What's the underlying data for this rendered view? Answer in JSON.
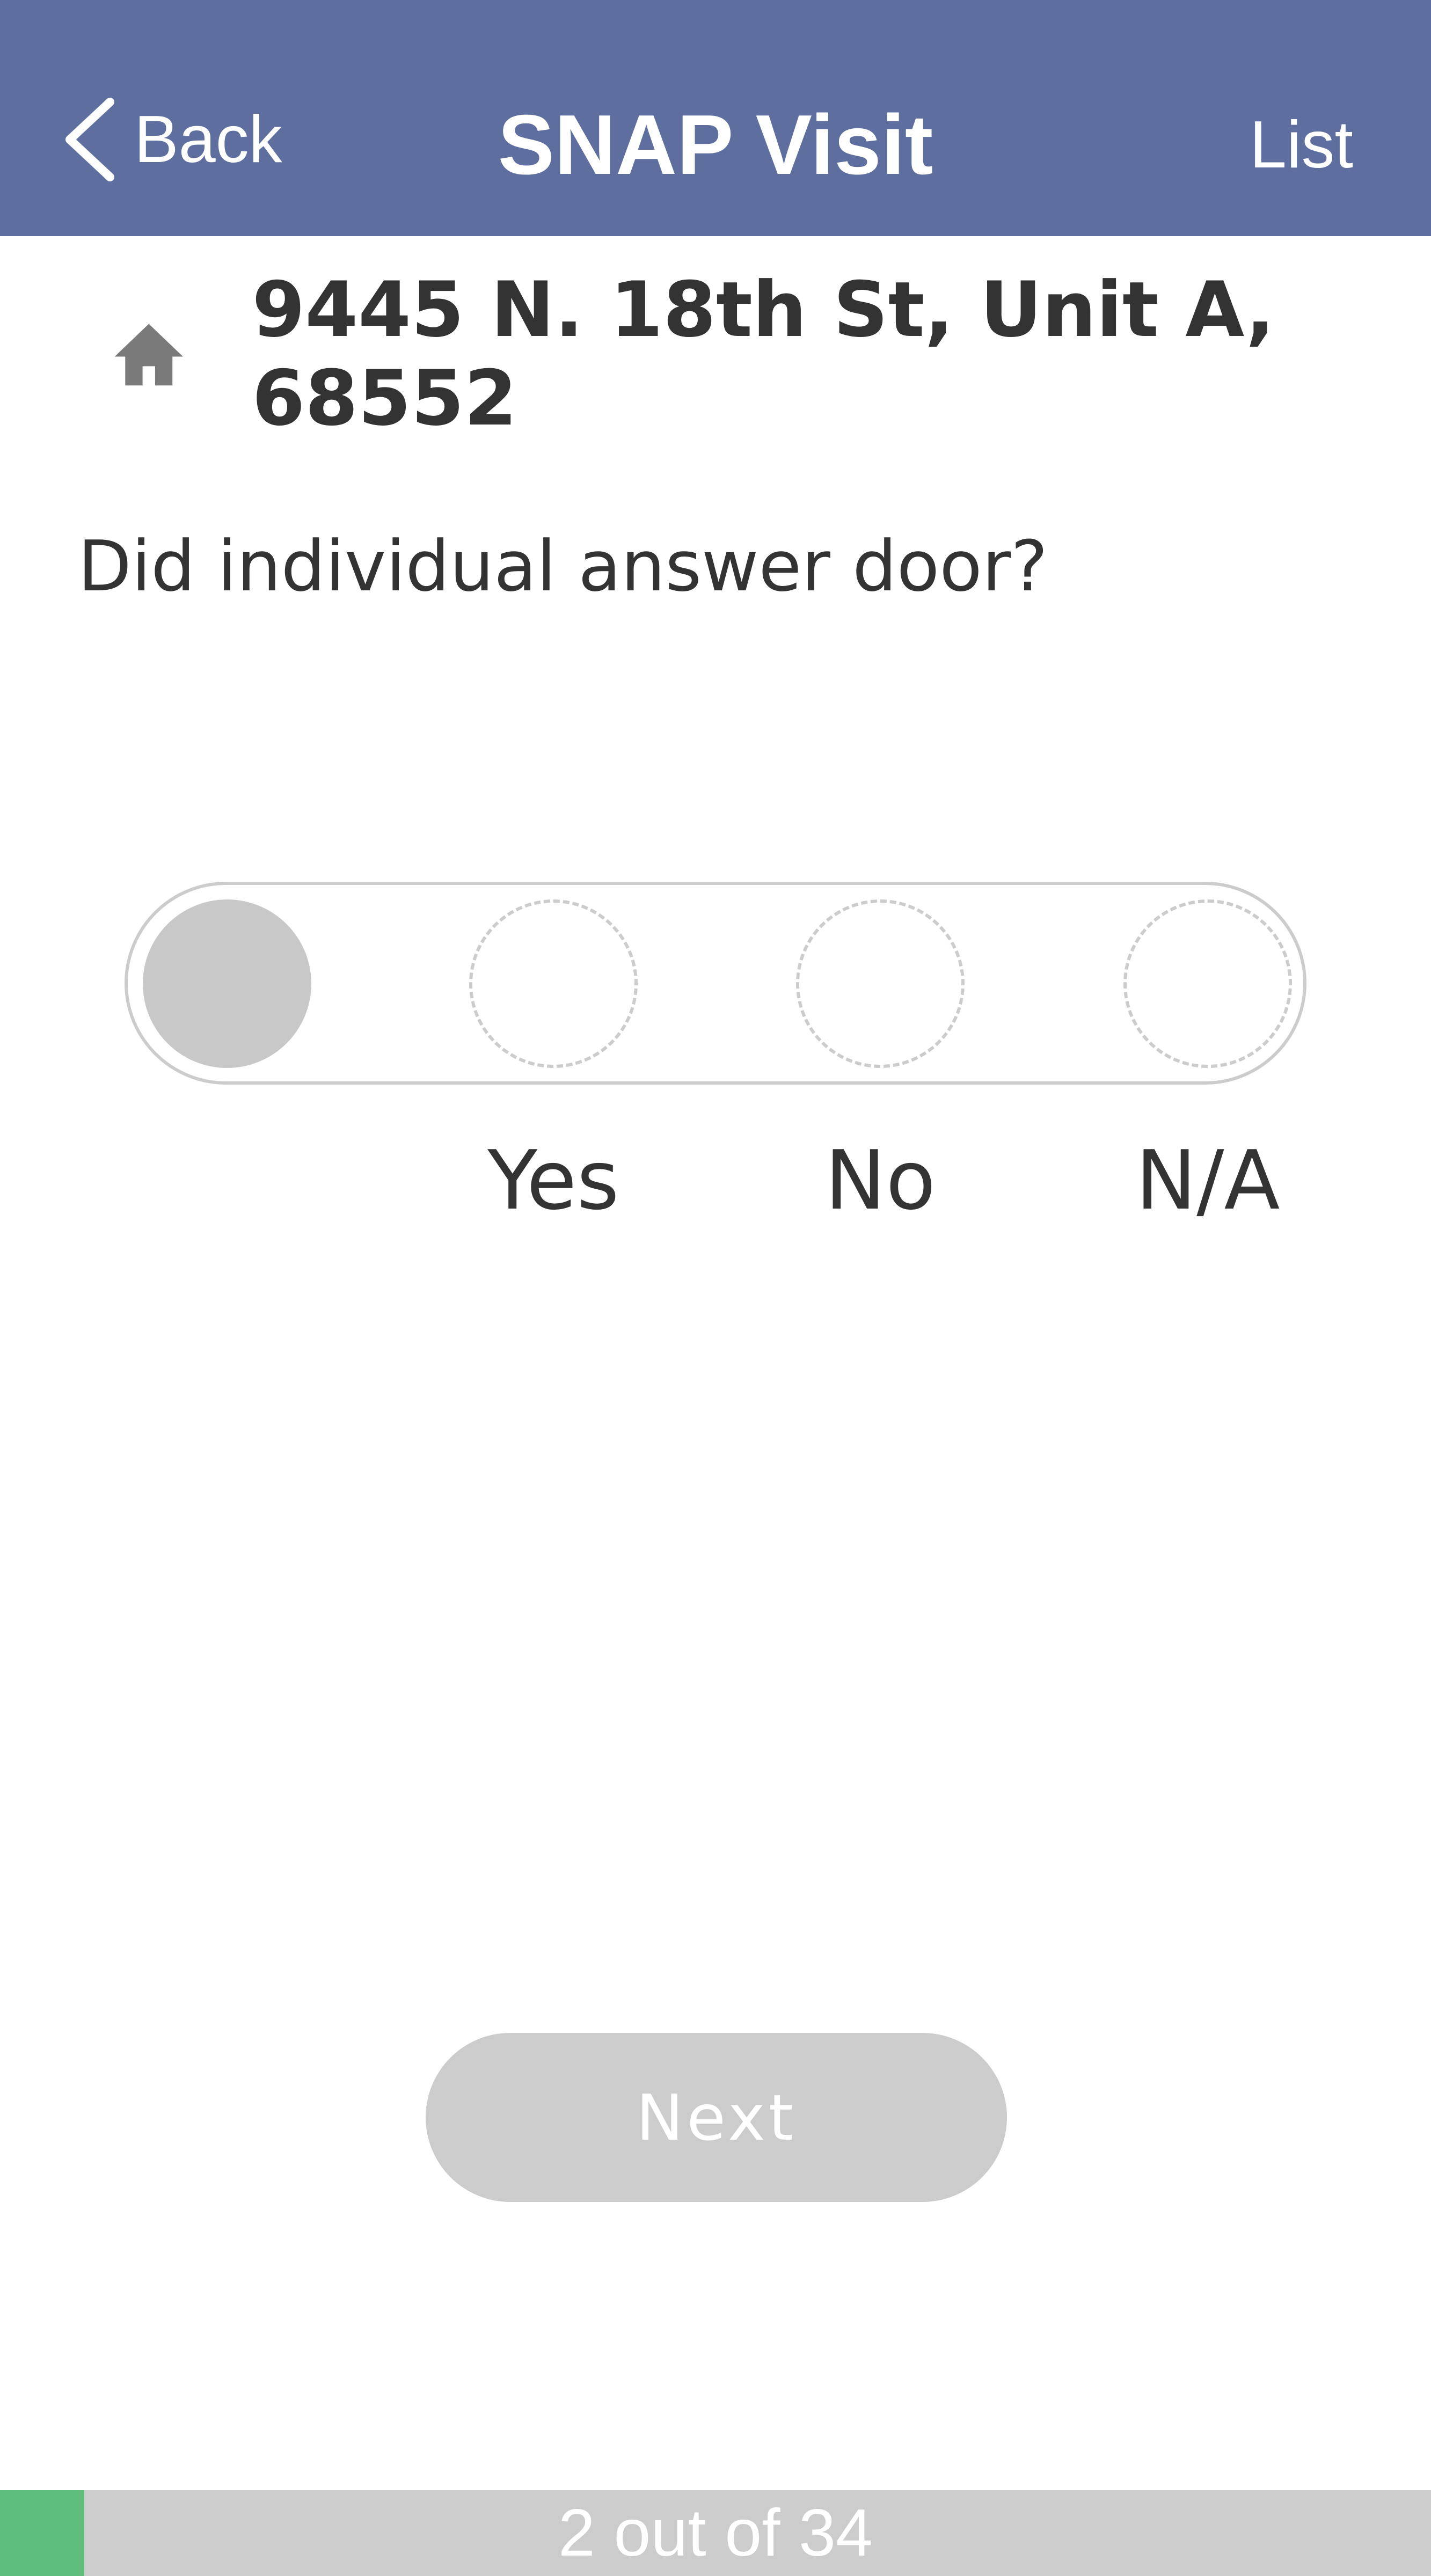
{
  "header": {
    "back_label": "Back",
    "title": "SNAP Visit",
    "list_label": "List",
    "background_color": "#5e6f9f"
  },
  "address": {
    "icon": "home-icon",
    "text": "9445 N. 18th St, Unit A, 68552"
  },
  "question": {
    "text": "Did individual answer door?",
    "options": [
      "Yes",
      "No",
      "N/A"
    ],
    "selected": null
  },
  "next_button": {
    "label": "Next",
    "enabled": false
  },
  "progress": {
    "current": 2,
    "total": 34,
    "text": "2 out of 34",
    "fill_color": "#5fbd7e"
  }
}
